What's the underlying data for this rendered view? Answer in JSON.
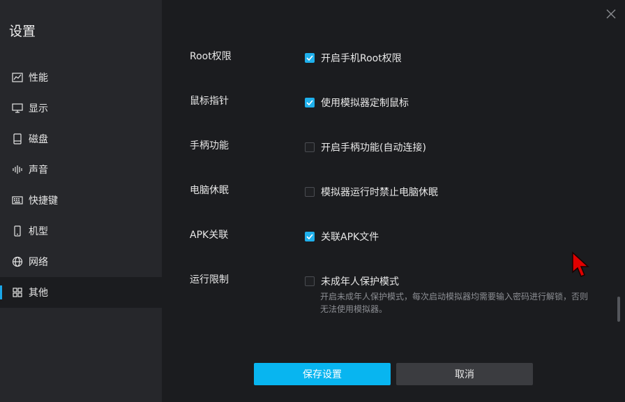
{
  "sidebar": {
    "title": "设置",
    "items": [
      {
        "label": "性能",
        "icon": "performance-chart-icon"
      },
      {
        "label": "显示",
        "icon": "monitor-icon"
      },
      {
        "label": "磁盘",
        "icon": "disk-icon"
      },
      {
        "label": "声音",
        "icon": "sound-wave-icon"
      },
      {
        "label": "快捷键",
        "icon": "keyboard-icon"
      },
      {
        "label": "机型",
        "icon": "phone-icon"
      },
      {
        "label": "网络",
        "icon": "globe-icon"
      },
      {
        "label": "其他",
        "icon": "grid-icon",
        "active": true
      }
    ]
  },
  "settings": [
    {
      "label": "Root权限",
      "option": "开启手机Root权限",
      "checked": true
    },
    {
      "label": "鼠标指针",
      "option": "使用模拟器定制鼠标",
      "checked": true
    },
    {
      "label": "手柄功能",
      "option": "开启手柄功能(自动连接)",
      "checked": false
    },
    {
      "label": "电脑休眠",
      "option": "模拟器运行时禁止电脑休眠",
      "checked": false
    },
    {
      "label": "APK关联",
      "option": "关联APK文件",
      "checked": true
    },
    {
      "label": "运行限制",
      "option": "未成年人保护模式",
      "checked": false,
      "description": "开启未成年人保护模式，每次启动模拟器均需要输入密码进行解锁，否则无法使用模拟器。"
    }
  ],
  "buttons": {
    "save": "保存设置",
    "cancel": "取消"
  },
  "colors": {
    "accent": "#08b5f0",
    "checkbox_on": "#1fb0ec",
    "cursor": "#e00000"
  }
}
